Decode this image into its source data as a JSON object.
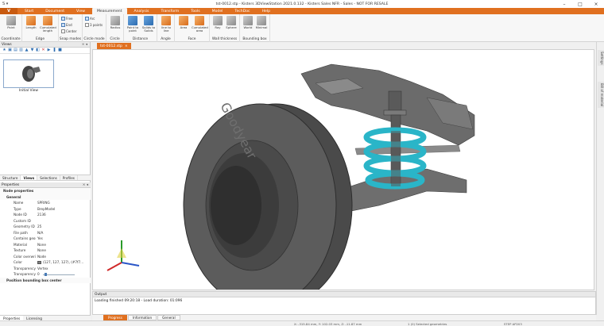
{
  "window": {
    "title": "tst-0012.stp - Kisters 3DViewStation 2021.0.132 - Kisters Sales NFR - Sales - NOT FOR RESALE",
    "quick_access": "S ▾"
  },
  "menu": {
    "app_button": "V",
    "tabs": [
      "Start",
      "Document",
      "View",
      "Measurement",
      "Analysis",
      "Transform",
      "Tools",
      "Model",
      "TechDoc",
      "Help"
    ],
    "active_tab": "Measurement"
  },
  "ribbon": {
    "groups": [
      {
        "label": "Coordinate",
        "buttons": [
          "Point"
        ]
      },
      {
        "label": "Edge",
        "buttons": [
          "Length",
          "Cumulated length"
        ]
      },
      {
        "label": "Snap modes",
        "buttons": [
          "Free",
          "End",
          "Center"
        ]
      },
      {
        "label": "Circle mode",
        "buttons": [
          "Arc",
          "3 points"
        ]
      },
      {
        "label": "Circle",
        "buttons": [
          "Radius"
        ]
      },
      {
        "label": "Distance",
        "buttons": [
          "Point to point",
          "Solids to Solids"
        ]
      },
      {
        "label": "Angle",
        "buttons": [
          "line to line"
        ]
      },
      {
        "label": "Face",
        "buttons": [
          "Area",
          "Cumulated area"
        ]
      },
      {
        "label": "Wall thickness",
        "buttons": [
          "Ray",
          "Sphere"
        ]
      },
      {
        "label": "Bounding box",
        "buttons": [
          "World",
          "Minimal"
        ]
      }
    ]
  },
  "left_panel": {
    "views_title": "Views",
    "view_item_label": "Initial View",
    "tabs": [
      "Structure",
      "Views",
      "Selections",
      "Profiles"
    ],
    "active_tab": "Views",
    "properties_title": "Properties",
    "sections": {
      "node_properties": "Node properties",
      "general": "General",
      "position_box": "Position bounding box center"
    },
    "properties": [
      {
        "k": "Name",
        "v": "SPRING"
      },
      {
        "k": "Type",
        "v": "BrepModel"
      },
      {
        "k": "Node ID",
        "v": "2136"
      },
      {
        "k": "Custom ID",
        "v": ""
      },
      {
        "k": "Geometry ID",
        "v": "25"
      },
      {
        "k": "File path",
        "v": "N/A"
      },
      {
        "k": "Contains geom...",
        "v": "Yes"
      },
      {
        "k": "Material",
        "v": "None"
      },
      {
        "k": "Texture",
        "v": "None"
      },
      {
        "k": "Color overwrite",
        "v": "Node"
      },
      {
        "k": "Color",
        "v": "(127, 127, 127), (#7f7..."
      },
      {
        "k": "Transparency ov...",
        "v": "Vertex"
      },
      {
        "k": "Transparency",
        "v": "0"
      }
    ],
    "bottom_tabs": [
      "Properties",
      "Licensing"
    ]
  },
  "document": {
    "tab_label": "tst-0012.stp",
    "tab_close": "×"
  },
  "viewport": {
    "tire_brand": "Goodyear",
    "accent": "#e07020",
    "spring_color": "#2ab5c8"
  },
  "right_strip": [
    "Settings",
    "Bill of material"
  ],
  "output": {
    "title": "Output",
    "text": "Loading finished 09:20:18 - Load duration: 01:096",
    "tabs": [
      "Progress",
      "Information",
      "General"
    ],
    "active_tab": "Progress"
  },
  "status": {
    "coords": "X: -315.84 mm, Y: 102.03 mm, Z: -11.87 mm",
    "selection": "1 (0) Selected geometries",
    "format": "STEP AP203"
  }
}
